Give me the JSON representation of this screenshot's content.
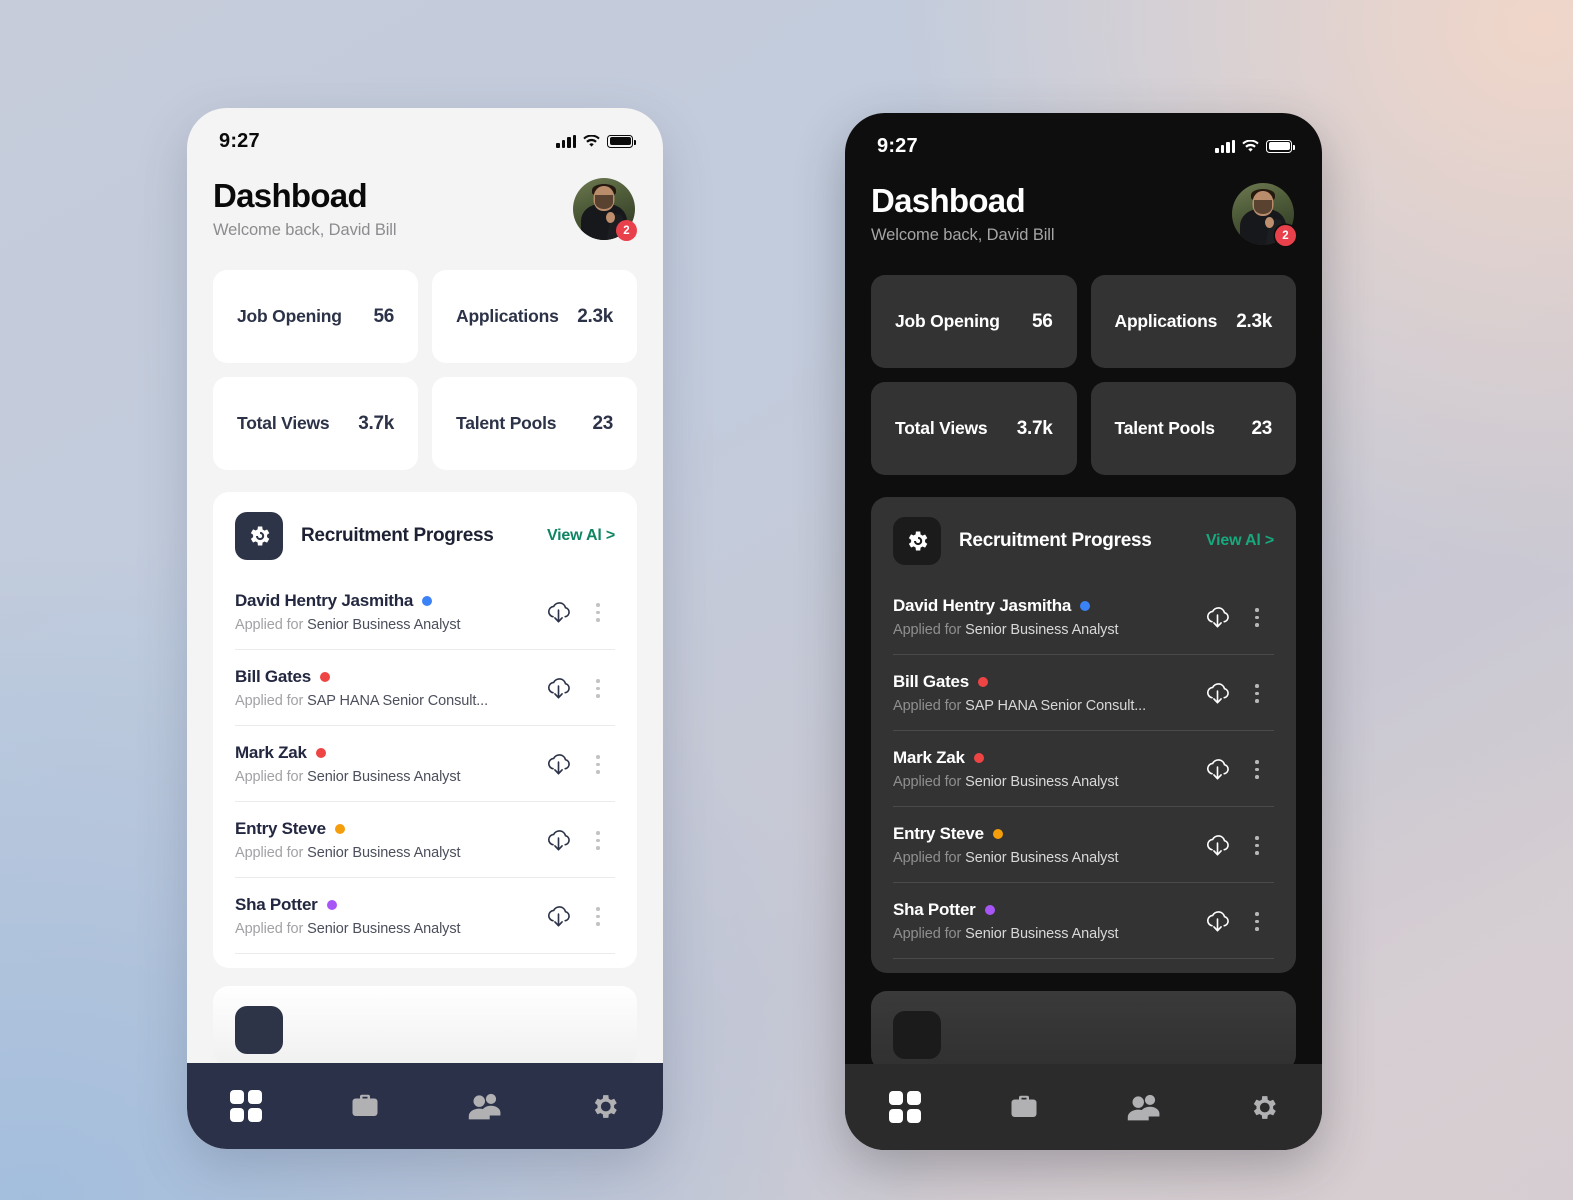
{
  "background": {
    "top_left": "#c6ccda",
    "top_right": "#f0d6c9",
    "bottom_left": "#a3bedd",
    "bottom_right": "#d6cdd2"
  },
  "theme_colors": {
    "light_bg": "#f4f4f4",
    "dark_bg": "#0e0e0e",
    "light_card": "#ffffff",
    "dark_card": "#333333",
    "navy": "#2b3148",
    "dark_navbar": "#2b2b2b",
    "accent_link": "#0f8463",
    "badge_red": "#e8414b"
  },
  "status_bar": {
    "time": "9:27",
    "icons": [
      "signal-icon",
      "wifi-icon",
      "battery-icon"
    ]
  },
  "header": {
    "title": "Dashboad",
    "subtitle": "Welcome back, David Bill",
    "avatar_name": "avatar",
    "notification_count": "2"
  },
  "stats": [
    {
      "label": "Job Opening",
      "value": "56"
    },
    {
      "label": "Applications",
      "value": "2.3k"
    },
    {
      "label": "Total Views",
      "value": "3.7k"
    },
    {
      "label": "Talent Pools",
      "value": "23"
    }
  ],
  "panel": {
    "icon": "gear-icon",
    "title": "Recruitment Progress",
    "link": "View Al >"
  },
  "candidates": [
    {
      "name": "David Hentry Jasmitha",
      "status_color": "#3b82f6",
      "applied_prefix": "Applied for ",
      "role": "Senior Business Analyst",
      "download_icon": "cloud-download-icon",
      "menu_icon": "kebab-menu-icon"
    },
    {
      "name": "Bill Gates",
      "status_color": "#ef4444",
      "applied_prefix": "Applied for ",
      "role": "SAP HANA Senior Consult...",
      "download_icon": "cloud-download-icon",
      "menu_icon": "kebab-menu-icon"
    },
    {
      "name": "Mark Zak",
      "status_color": "#ef4444",
      "applied_prefix": "Applied for ",
      "role": "Senior Business Analyst",
      "download_icon": "cloud-download-icon",
      "menu_icon": "kebab-menu-icon"
    },
    {
      "name": "Entry Steve",
      "status_color": "#f59e0b",
      "applied_prefix": "Applied for ",
      "role": "Senior Business Analyst",
      "download_icon": "cloud-download-icon",
      "menu_icon": "kebab-menu-icon"
    },
    {
      "name": "Sha Potter",
      "status_color": "#a855f7",
      "applied_prefix": "Applied for ",
      "role": "Senior Business Analyst",
      "download_icon": "cloud-download-icon",
      "menu_icon": "kebab-menu-icon"
    }
  ],
  "tabbar": [
    {
      "name": "dashboard",
      "icon": "grid-icon",
      "active": true
    },
    {
      "name": "jobs",
      "icon": "briefcase-icon",
      "active": false
    },
    {
      "name": "candidates",
      "icon": "people-icon",
      "active": false
    },
    {
      "name": "settings",
      "icon": "gear-icon",
      "active": false
    }
  ]
}
